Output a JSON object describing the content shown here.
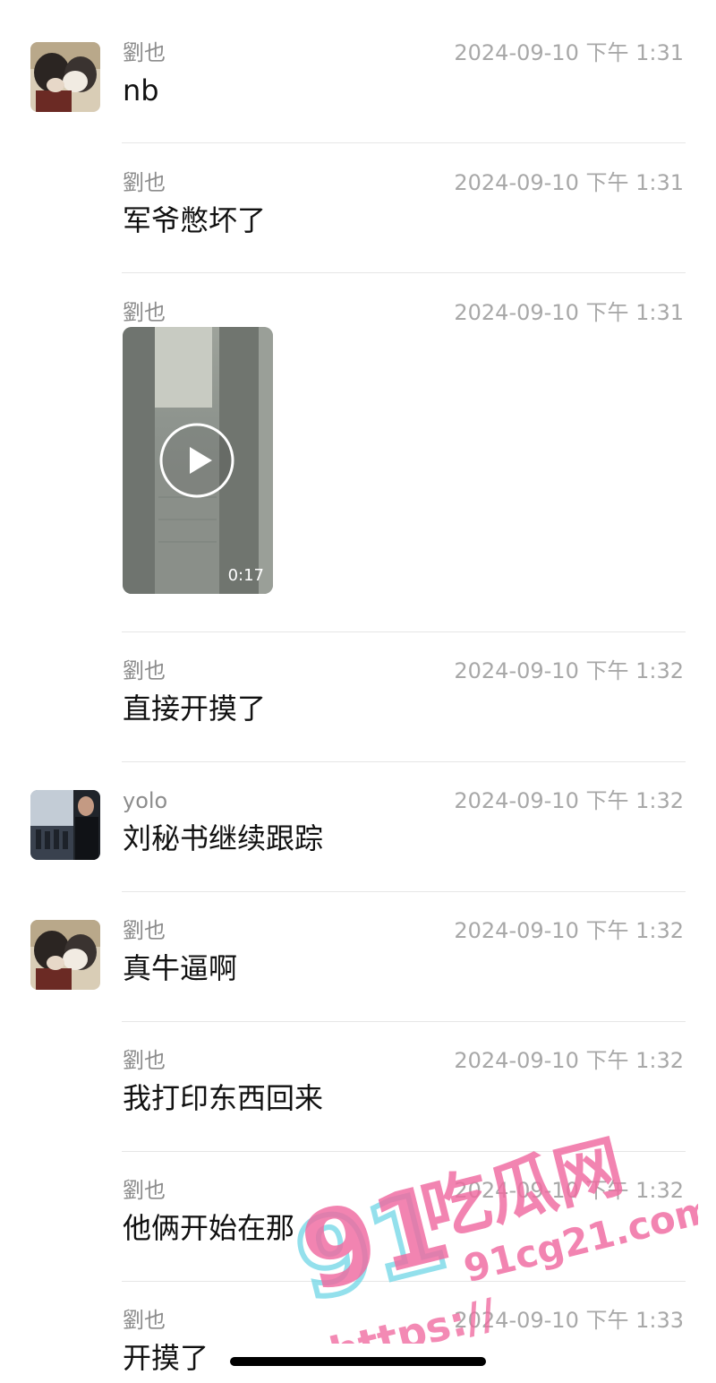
{
  "messages": [
    {
      "sender": "劉也",
      "time": "2024-09-10 下午 1:31",
      "text": "nb",
      "avatar": "cat"
    },
    {
      "sender": "劉也",
      "time": "2024-09-10 下午 1:31",
      "text": "军爷憋坏了"
    },
    {
      "sender": "劉也",
      "time": "2024-09-10 下午 1:31",
      "video": {
        "duration": "0:17"
      }
    },
    {
      "sender": "劉也",
      "time": "2024-09-10 下午 1:32",
      "text": "直接开摸了"
    },
    {
      "sender": "yolo",
      "time": "2024-09-10 下午 1:32",
      "text": "刘秘书继续跟踪",
      "avatar": "person"
    },
    {
      "sender": "劉也",
      "time": "2024-09-10 下午 1:32",
      "text": "真牛逼啊",
      "avatar": "cat"
    },
    {
      "sender": "劉也",
      "time": "2024-09-10 下午 1:32",
      "text": "我打印东西回来"
    },
    {
      "sender": "劉也",
      "time": "2024-09-10 下午 1:32",
      "text": "他俩开始在那"
    },
    {
      "sender": "劉也",
      "time": "2024-09-10 下午 1:33",
      "text": "开摸了"
    }
  ],
  "watermark": {
    "number": "91",
    "brand": "吃瓜网",
    "domain": "91cg21.com",
    "scheme": "https://"
  },
  "colors": {
    "watermark_pink": "#f06aa0",
    "watermark_cyan": "#6fd6e6",
    "sender": "#8c8c8c",
    "time": "#a8a8a8",
    "divider": "#e6e6e6"
  }
}
